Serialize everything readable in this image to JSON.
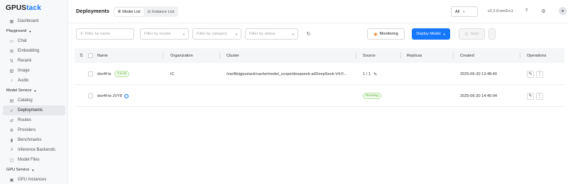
{
  "app": {
    "logo_main": "GPUS",
    "logo_accent": "tack"
  },
  "sidebar": {
    "items": [
      {
        "label": "Dashboard",
        "icon": "dashboard-icon",
        "glyph": "▦"
      },
      {
        "group": "Playground"
      },
      {
        "label": "Chat",
        "icon": "chat-icon",
        "glyph": "▭"
      },
      {
        "label": "Embedding",
        "icon": "embedding-icon",
        "glyph": "⊞"
      },
      {
        "label": "Rerank",
        "icon": "rerank-icon",
        "glyph": "⇅"
      },
      {
        "label": "Image",
        "icon": "image-icon",
        "glyph": "▨"
      },
      {
        "label": "Audio",
        "icon": "audio-icon",
        "glyph": "♪"
      },
      {
        "group": "Model Service"
      },
      {
        "label": "Catalog",
        "icon": "catalog-icon",
        "glyph": "▤"
      },
      {
        "label": "Deployments",
        "icon": "rocket-icon",
        "glyph": "➶",
        "active": true
      },
      {
        "label": "Routes",
        "icon": "routes-icon",
        "glyph": "⇄"
      },
      {
        "label": "Providers",
        "icon": "providers-icon",
        "glyph": "⚙"
      },
      {
        "label": "Benchmarks",
        "icon": "benchmarks-icon",
        "glyph": "▮"
      },
      {
        "label": "Inference Backends",
        "icon": "backends-icon",
        "glyph": "≡"
      },
      {
        "label": "Model Files",
        "icon": "files-icon",
        "glyph": "▢"
      },
      {
        "group": "GPU Service"
      },
      {
        "label": "GPU Instances",
        "icon": "gpu-icon",
        "glyph": "▣"
      }
    ]
  },
  "header": {
    "title": "Deployments",
    "tabs": [
      {
        "label": "Model List",
        "selected": true
      },
      {
        "label": "Instance List",
        "selected": false
      }
    ],
    "scope_select": "All",
    "version": "v2.2.0-ent1rc1"
  },
  "filters": {
    "name_placeholder": "Filter by name",
    "cluster_placeholder": "Filter by cluster",
    "category_placeholder": "Filter by category",
    "status_placeholder": "Filter by status"
  },
  "actions": {
    "monitoring": "Monitoring",
    "deploy": "Deploy Model",
    "start": "Start"
  },
  "table": {
    "columns": [
      "Name",
      "Organization",
      "Cluster",
      "Source",
      "Replicas",
      "Created",
      "Operations"
    ],
    "rows": [
      {
        "name": "dsv4f-ts",
        "tag": "LLM",
        "organization": "IC",
        "cluster": "/var/lib/gpustack/cache/model_scope/deepseek-ai/DeepSeek-V4-F...",
        "replicas": "1 / 1",
        "created": "2025-06-30 13:48:40"
      },
      {
        "name": "dsv4f-ts-JVY8",
        "status": "Running",
        "created": "2025-06-30 14:45:04"
      }
    ]
  },
  "colors": {
    "accent": "#1677ff",
    "success": "#52a82b",
    "monitor": "#f07c1a"
  }
}
